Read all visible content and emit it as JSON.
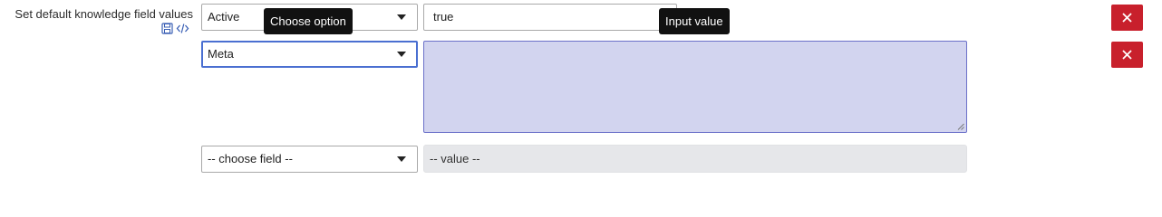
{
  "section": {
    "label": "Set default knowledge field values",
    "save_icon": "save-icon",
    "code_icon": "code-icon"
  },
  "rows": [
    {
      "field": "Active",
      "value": "true",
      "field_tooltip": "Choose option",
      "value_tooltip": "Input value",
      "delete_icon": "close-icon"
    },
    {
      "field": "Meta",
      "value": "",
      "delete_icon": "close-icon"
    }
  ],
  "new_row": {
    "field_placeholder": "-- choose field --",
    "value_placeholder": "-- value --"
  },
  "colors": {
    "delete_button": "#c8202c",
    "textarea_bg": "#d2d4ef",
    "focus_border": "#4a6fd1",
    "tooltip_bg": "#111111"
  }
}
